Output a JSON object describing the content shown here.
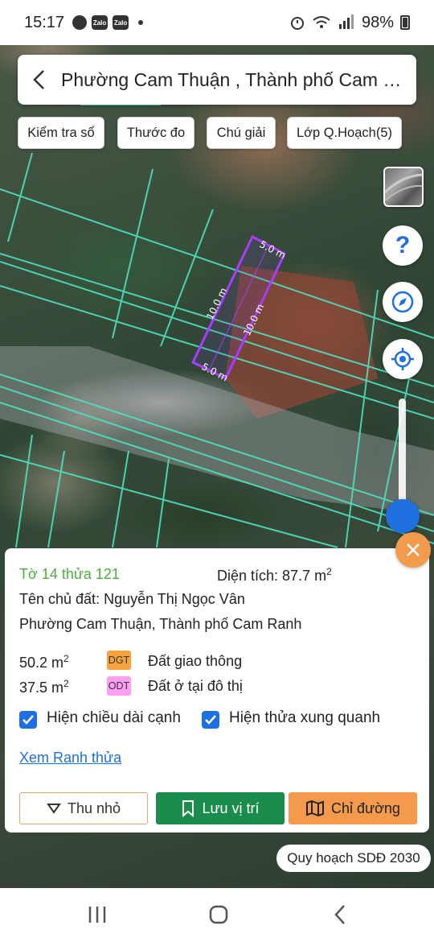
{
  "status_bar": {
    "time": "15:17",
    "notification_icons": [
      "messenger-icon",
      "zalo-icon",
      "zalo-icon"
    ],
    "zalo_label": "Zalo",
    "battery": "98%"
  },
  "header": {
    "title": "Phường Cam Thuận , Thành phố Cam R..."
  },
  "toolbar": {
    "chips": [
      "Kiểm tra sổ",
      "Thước đo",
      "Chú giải",
      "Lớp Q.Hoạch(5)"
    ]
  },
  "map": {
    "parcel_edges": [
      "5.0 m",
      "10.0 m",
      "10.0 m",
      "5.0 m"
    ],
    "parcel_color": "#a83cff",
    "boundary_color": "#4fe0c0"
  },
  "controls": {
    "help_label": "?",
    "zoom_level": 1.0
  },
  "info": {
    "parcel_id": "Tờ 14 thửa 121",
    "area_label": "Diện tích: 87.7 m",
    "area_sup": "2",
    "owner": "Tên chủ đất: Nguyễn Thị Ngọc Vân",
    "address": "Phường Cam Thuận, Thành phố Cam Ranh",
    "land_uses": [
      {
        "area": "50.2 m",
        "sup": "2",
        "code": "DGT",
        "name": "Đất giao thông",
        "color": "#f7a33d"
      },
      {
        "area": "37.5 m",
        "sup": "2",
        "code": "ODT",
        "name": "Đất ở tại đô thị",
        "color": "#ff9ff3"
      }
    ],
    "show_edges_label": "Hiện chiều dài cạnh",
    "show_neighbors_label": "Hiện thửa xung quanh",
    "show_edges_checked": true,
    "show_neighbors_checked": true,
    "view_boundary_link": "Xem Ranh thửa",
    "buttons": {
      "minimize": "Thu nhỏ",
      "save_location": "Lưu vị trí",
      "directions": "Chỉ đường"
    },
    "accent_colors": {
      "green": "#1b8c4c",
      "orange": "#f39a4d",
      "blue": "#1e6fe0"
    }
  },
  "plan_layer_tag": "Quy hoạch SDĐ 2030"
}
